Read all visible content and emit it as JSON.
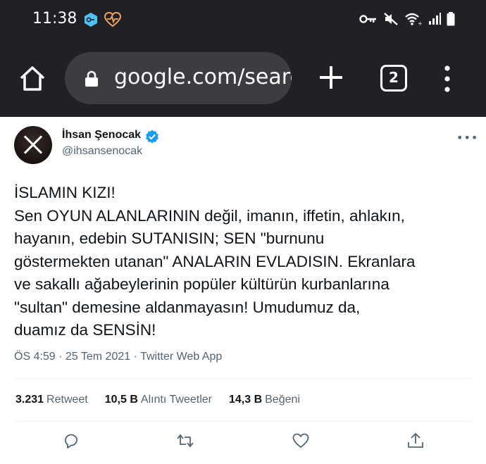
{
  "status_bar": {
    "time": "11:38"
  },
  "browser": {
    "url": "google.com/search",
    "tab_count": "2"
  },
  "tweet": {
    "author_name": "İhsan Şenocak",
    "author_handle": "@ihsansenocak",
    "more_label": "•••",
    "text_lines": [
      "İSLAMIN KIZI!",
      "Sen OYUN ALANLARININ değil, imanın, iffetin, ahlakın,",
      "hayanın, edebin SUTANISIN; SEN \"burnunu",
      "göstermekten utanan\" ANALARIN EVLADISIN. Ekranlara",
      "ve sakallı ağabeylerinin popüler kültürün kurbanlarına",
      "\"sultan\" demesine aldanmayasın! Umudumuz da,",
      "duamız da SENSİN!"
    ],
    "meta": "ÖS 4:59 · 25 Tem 2021 · Twitter Web App",
    "stats": {
      "retweets_count": "3.231",
      "retweets_label": "Retweet",
      "quotes_count": "10,5 B",
      "quotes_label": "Alıntı Tweetler",
      "likes_count": "14,3 B",
      "likes_label": "Beğeni"
    }
  },
  "colors": {
    "chrome_bg": "#202124",
    "urlbar_bg": "#3c3d40",
    "verified_blue": "#1d9bf0",
    "text_primary": "#0f1419",
    "text_secondary": "#536471"
  }
}
